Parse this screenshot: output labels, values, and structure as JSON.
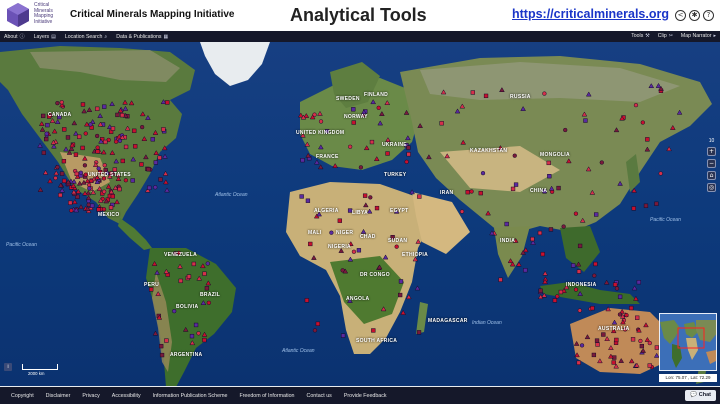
{
  "header": {
    "logo_text": "Critical Minerals Mapping Initiative",
    "org_name": "Critical Minerals Mapping Initiative",
    "title": "Analytical Tools",
    "url": "https://criticalminerals.org",
    "icons": [
      "share-icon",
      "settings-icon",
      "help-icon"
    ]
  },
  "toolbar": {
    "left": [
      {
        "label": "About",
        "icon": "info-icon"
      },
      {
        "label": "Layers",
        "icon": "layers-icon"
      },
      {
        "label": "Location Search",
        "icon": "search-icon"
      },
      {
        "label": "Data & Publications",
        "icon": "document-icon"
      }
    ],
    "right": [
      {
        "label": "Tools",
        "icon": "tools-icon"
      },
      {
        "label": "Clip",
        "icon": "clip-icon"
      },
      {
        "label": "Map Narrator",
        "icon": "narrator-icon"
      }
    ]
  },
  "map": {
    "ocean_labels": [
      "Pacific Ocean",
      "Pacific Ocean",
      "Indian Ocean",
      "Atlantic Ocean",
      "Atlantic Ocean"
    ],
    "country_labels": [
      "CANADA",
      "UNITED STATES",
      "MEXICO",
      "VENEZUELA",
      "BRAZIL",
      "PERU",
      "BOLIVIA",
      "ARGENTINA",
      "ALGERIA",
      "LIBYA",
      "EGYPT",
      "MALI",
      "NIGER",
      "CHAD",
      "SUDAN",
      "NIGERIA",
      "ETHIOPIA",
      "DR CONGO",
      "ANGOLA",
      "SOUTH AFRICA",
      "SWEDEN",
      "FINLAND",
      "NORWAY",
      "UNITED KINGDOM",
      "FRANCE",
      "UKRAINE",
      "TURKEY",
      "IRAN",
      "RUSSIA",
      "KAZAKHSTAN",
      "MONGOLIA",
      "CHINA",
      "INDIA",
      "INDONESIA",
      "AUSTRALIA",
      "MADAGASCAR"
    ],
    "zoom_level": "10",
    "scale_label": "2000 km",
    "coords": "Lon: 75.07 , Lat: 72.29",
    "info_label": "i"
  },
  "footer": {
    "links": [
      "Copyright",
      "Disclaimer",
      "Privacy",
      "Accessibility",
      "Information Publication Scheme",
      "Freedom of Information",
      "Contact us",
      "Provide Feedback"
    ],
    "chat_label": "Chat"
  },
  "colors": {
    "toolbar_bg": "#15182a",
    "url": "#1a35c8",
    "ocean": "#0e3a7a",
    "marker_red": "#c8102e",
    "marker_purple": "#5a2aa0",
    "logo_purple": "#6b52b6"
  }
}
